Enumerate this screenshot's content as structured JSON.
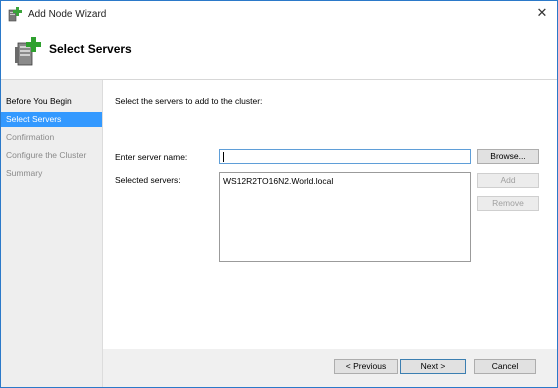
{
  "window": {
    "title": "Add Node Wizard",
    "close_glyph": "✕"
  },
  "header": {
    "title": "Select Servers",
    "icon": "cluster-server-add-icon"
  },
  "sidebar": {
    "items": [
      {
        "label": "Before You Begin",
        "state": "done"
      },
      {
        "label": "Select Servers",
        "state": "active"
      },
      {
        "label": "Confirmation",
        "state": "pending"
      },
      {
        "label": "Configure the Cluster",
        "state": "pending"
      },
      {
        "label": "Summary",
        "state": "pending"
      }
    ]
  },
  "main": {
    "instruction": "Select the servers to add to the cluster:",
    "server_name_label": "Enter server name:",
    "server_name_value": "",
    "selected_label": "Selected servers:",
    "selected_servers": [
      "WS12R2TO16N2.World.local"
    ],
    "browse_label": "Browse...",
    "add_label": "Add",
    "remove_label": "Remove"
  },
  "footer": {
    "previous_label": "< Previous",
    "next_label": "Next >",
    "cancel_label": "Cancel"
  },
  "colors": {
    "accent": "#3399ff",
    "window_border": "#2b79c9",
    "sidebar_bg": "#eeeeee"
  }
}
